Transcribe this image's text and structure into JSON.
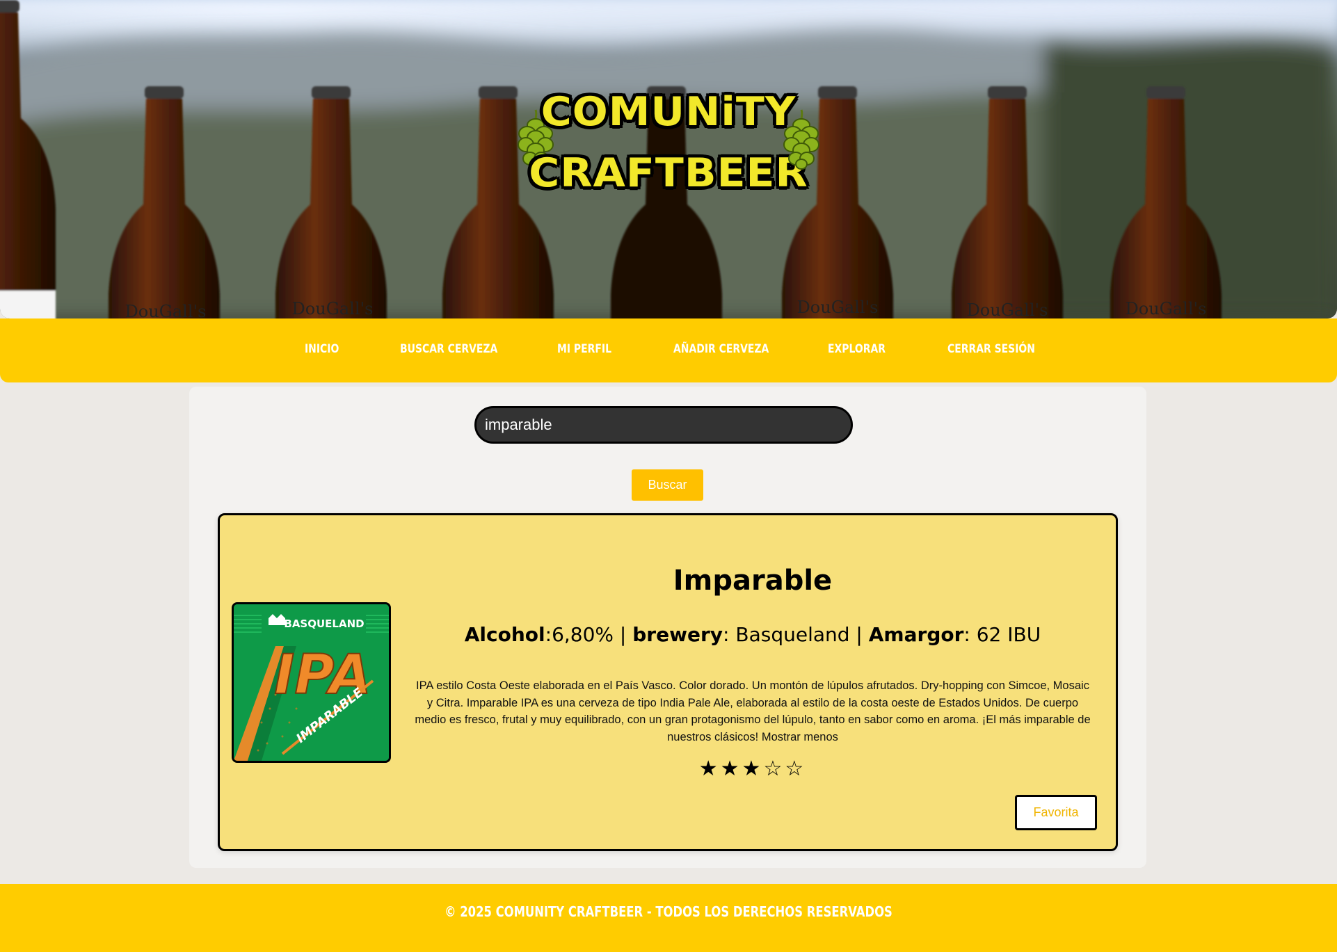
{
  "header": {
    "logo_line1": "COMUNiTY",
    "logo_line2": "CRAFTBEER",
    "bottle_label": "DouGall's"
  },
  "nav": {
    "items": [
      "INICIO",
      "BUSCAR CERVEZA",
      "MI PERFIL",
      "AÑADIR CERVEZA",
      "EXPLORAR",
      "CERRAR SESIÓN"
    ]
  },
  "search": {
    "value": "imparable",
    "button_label": "Buscar"
  },
  "result": {
    "name": "Imparable",
    "alcohol_label": "Alcohol",
    "alcohol_value": ":6,80%",
    "sep": " | ",
    "brewery_label": "brewery",
    "brewery_value": ": Basqueland",
    "amargor_label": "Amargor",
    "amargor_value": ": 62 IBU",
    "description": "IPA estilo Costa Oeste elaborada en el País Vasco. Color dorado. Un montón de lúpulos afrutados. Dry-hopping con Simcoe, Mosaic y Citra. Imparable IPA es una cerveza de tipo India Pale Ale, elaborada al estilo de la costa oeste de Estados Unidos. De cuerpo medio es fresco, frutal y muy equilibrado, con un gran protagonismo del lúpulo, tanto en sabor como en aroma. ¡El más imparable de nuestros clásicos!",
    "toggle_label": "Mostrar menos",
    "rating": 3,
    "rating_max": 5,
    "favorite_label": "Favorita",
    "image_brand": "BASQUELAND",
    "image_style": "IPA",
    "image_name": "IMPARABLE"
  },
  "footer": {
    "text": "© 2025 COMUNITY CRAFTBEER - TODOS LOS DERECHOS RESERVADOS"
  },
  "colors": {
    "accent": "#ffcc00",
    "card_bg": "#f7e07b",
    "button": "#ffc000"
  }
}
